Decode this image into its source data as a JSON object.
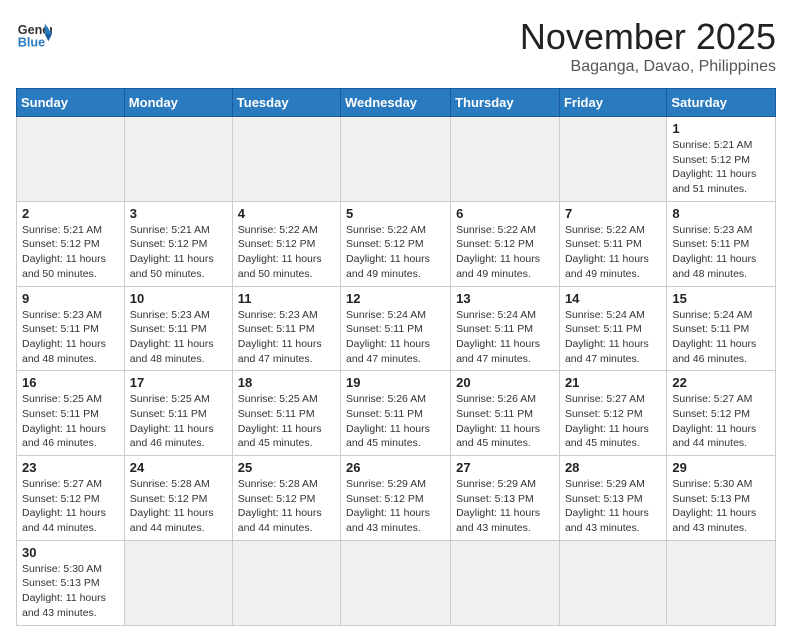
{
  "header": {
    "logo_general": "General",
    "logo_blue": "Blue",
    "month_title": "November 2025",
    "location": "Baganga, Davao, Philippines"
  },
  "weekdays": [
    "Sunday",
    "Monday",
    "Tuesday",
    "Wednesday",
    "Thursday",
    "Friday",
    "Saturday"
  ],
  "weeks": [
    [
      {
        "day": "",
        "info": ""
      },
      {
        "day": "",
        "info": ""
      },
      {
        "day": "",
        "info": ""
      },
      {
        "day": "",
        "info": ""
      },
      {
        "day": "",
        "info": ""
      },
      {
        "day": "",
        "info": ""
      },
      {
        "day": "1",
        "info": "Sunrise: 5:21 AM\nSunset: 5:12 PM\nDaylight: 11 hours\nand 51 minutes."
      }
    ],
    [
      {
        "day": "2",
        "info": "Sunrise: 5:21 AM\nSunset: 5:12 PM\nDaylight: 11 hours\nand 50 minutes."
      },
      {
        "day": "3",
        "info": "Sunrise: 5:21 AM\nSunset: 5:12 PM\nDaylight: 11 hours\nand 50 minutes."
      },
      {
        "day": "4",
        "info": "Sunrise: 5:22 AM\nSunset: 5:12 PM\nDaylight: 11 hours\nand 50 minutes."
      },
      {
        "day": "5",
        "info": "Sunrise: 5:22 AM\nSunset: 5:12 PM\nDaylight: 11 hours\nand 49 minutes."
      },
      {
        "day": "6",
        "info": "Sunrise: 5:22 AM\nSunset: 5:12 PM\nDaylight: 11 hours\nand 49 minutes."
      },
      {
        "day": "7",
        "info": "Sunrise: 5:22 AM\nSunset: 5:11 PM\nDaylight: 11 hours\nand 49 minutes."
      },
      {
        "day": "8",
        "info": "Sunrise: 5:23 AM\nSunset: 5:11 PM\nDaylight: 11 hours\nand 48 minutes."
      }
    ],
    [
      {
        "day": "9",
        "info": "Sunrise: 5:23 AM\nSunset: 5:11 PM\nDaylight: 11 hours\nand 48 minutes."
      },
      {
        "day": "10",
        "info": "Sunrise: 5:23 AM\nSunset: 5:11 PM\nDaylight: 11 hours\nand 48 minutes."
      },
      {
        "day": "11",
        "info": "Sunrise: 5:23 AM\nSunset: 5:11 PM\nDaylight: 11 hours\nand 47 minutes."
      },
      {
        "day": "12",
        "info": "Sunrise: 5:24 AM\nSunset: 5:11 PM\nDaylight: 11 hours\nand 47 minutes."
      },
      {
        "day": "13",
        "info": "Sunrise: 5:24 AM\nSunset: 5:11 PM\nDaylight: 11 hours\nand 47 minutes."
      },
      {
        "day": "14",
        "info": "Sunrise: 5:24 AM\nSunset: 5:11 PM\nDaylight: 11 hours\nand 47 minutes."
      },
      {
        "day": "15",
        "info": "Sunrise: 5:24 AM\nSunset: 5:11 PM\nDaylight: 11 hours\nand 46 minutes."
      }
    ],
    [
      {
        "day": "16",
        "info": "Sunrise: 5:25 AM\nSunset: 5:11 PM\nDaylight: 11 hours\nand 46 minutes."
      },
      {
        "day": "17",
        "info": "Sunrise: 5:25 AM\nSunset: 5:11 PM\nDaylight: 11 hours\nand 46 minutes."
      },
      {
        "day": "18",
        "info": "Sunrise: 5:25 AM\nSunset: 5:11 PM\nDaylight: 11 hours\nand 45 minutes."
      },
      {
        "day": "19",
        "info": "Sunrise: 5:26 AM\nSunset: 5:11 PM\nDaylight: 11 hours\nand 45 minutes."
      },
      {
        "day": "20",
        "info": "Sunrise: 5:26 AM\nSunset: 5:11 PM\nDaylight: 11 hours\nand 45 minutes."
      },
      {
        "day": "21",
        "info": "Sunrise: 5:27 AM\nSunset: 5:12 PM\nDaylight: 11 hours\nand 45 minutes."
      },
      {
        "day": "22",
        "info": "Sunrise: 5:27 AM\nSunset: 5:12 PM\nDaylight: 11 hours\nand 44 minutes."
      }
    ],
    [
      {
        "day": "23",
        "info": "Sunrise: 5:27 AM\nSunset: 5:12 PM\nDaylight: 11 hours\nand 44 minutes."
      },
      {
        "day": "24",
        "info": "Sunrise: 5:28 AM\nSunset: 5:12 PM\nDaylight: 11 hours\nand 44 minutes."
      },
      {
        "day": "25",
        "info": "Sunrise: 5:28 AM\nSunset: 5:12 PM\nDaylight: 11 hours\nand 44 minutes."
      },
      {
        "day": "26",
        "info": "Sunrise: 5:29 AM\nSunset: 5:12 PM\nDaylight: 11 hours\nand 43 minutes."
      },
      {
        "day": "27",
        "info": "Sunrise: 5:29 AM\nSunset: 5:13 PM\nDaylight: 11 hours\nand 43 minutes."
      },
      {
        "day": "28",
        "info": "Sunrise: 5:29 AM\nSunset: 5:13 PM\nDaylight: 11 hours\nand 43 minutes."
      },
      {
        "day": "29",
        "info": "Sunrise: 5:30 AM\nSunset: 5:13 PM\nDaylight: 11 hours\nand 43 minutes."
      }
    ],
    [
      {
        "day": "30",
        "info": "Sunrise: 5:30 AM\nSunset: 5:13 PM\nDaylight: 11 hours\nand 43 minutes."
      },
      {
        "day": "",
        "info": ""
      },
      {
        "day": "",
        "info": ""
      },
      {
        "day": "",
        "info": ""
      },
      {
        "day": "",
        "info": ""
      },
      {
        "day": "",
        "info": ""
      },
      {
        "day": "",
        "info": ""
      }
    ]
  ]
}
